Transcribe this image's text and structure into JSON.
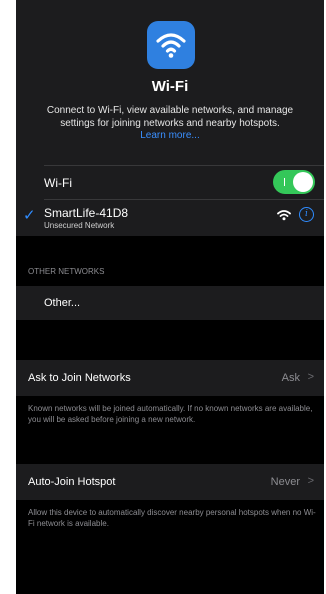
{
  "header": {
    "icon": "wifi-icon",
    "title": "Wi-Fi",
    "description": "Connect to Wi-Fi, view available networks, and manage settings for joining networks and nearby hotspots.",
    "learn_more": "Learn more..."
  },
  "wifi_toggle": {
    "label": "Wi-Fi",
    "on": true,
    "on_color": "#34c759"
  },
  "current_network": {
    "name": "SmartLife-41D8",
    "subtitle": "Unsecured Network",
    "check_icon": "checkmark-icon",
    "signal_icon": "wifi-signal-icon",
    "info_icon": "info-icon",
    "info_glyph": "i"
  },
  "other_networks": {
    "header": "OTHER NETWORKS",
    "other_label": "Other..."
  },
  "ask_to_join": {
    "label": "Ask to Join Networks",
    "value": "Ask",
    "chevron": ">",
    "footnote": "Known networks will be joined automatically. If no known networks are available, you will be asked before joining a new network."
  },
  "auto_join": {
    "label": "Auto-Join Hotspot",
    "value": "Never",
    "chevron": ">",
    "footnote": "Allow this device to automatically discover nearby personal hotspots when no Wi-Fi network is available."
  },
  "colors": {
    "accent": "#2f8cff",
    "background": "#000000",
    "cell": "#1c1c1e"
  }
}
